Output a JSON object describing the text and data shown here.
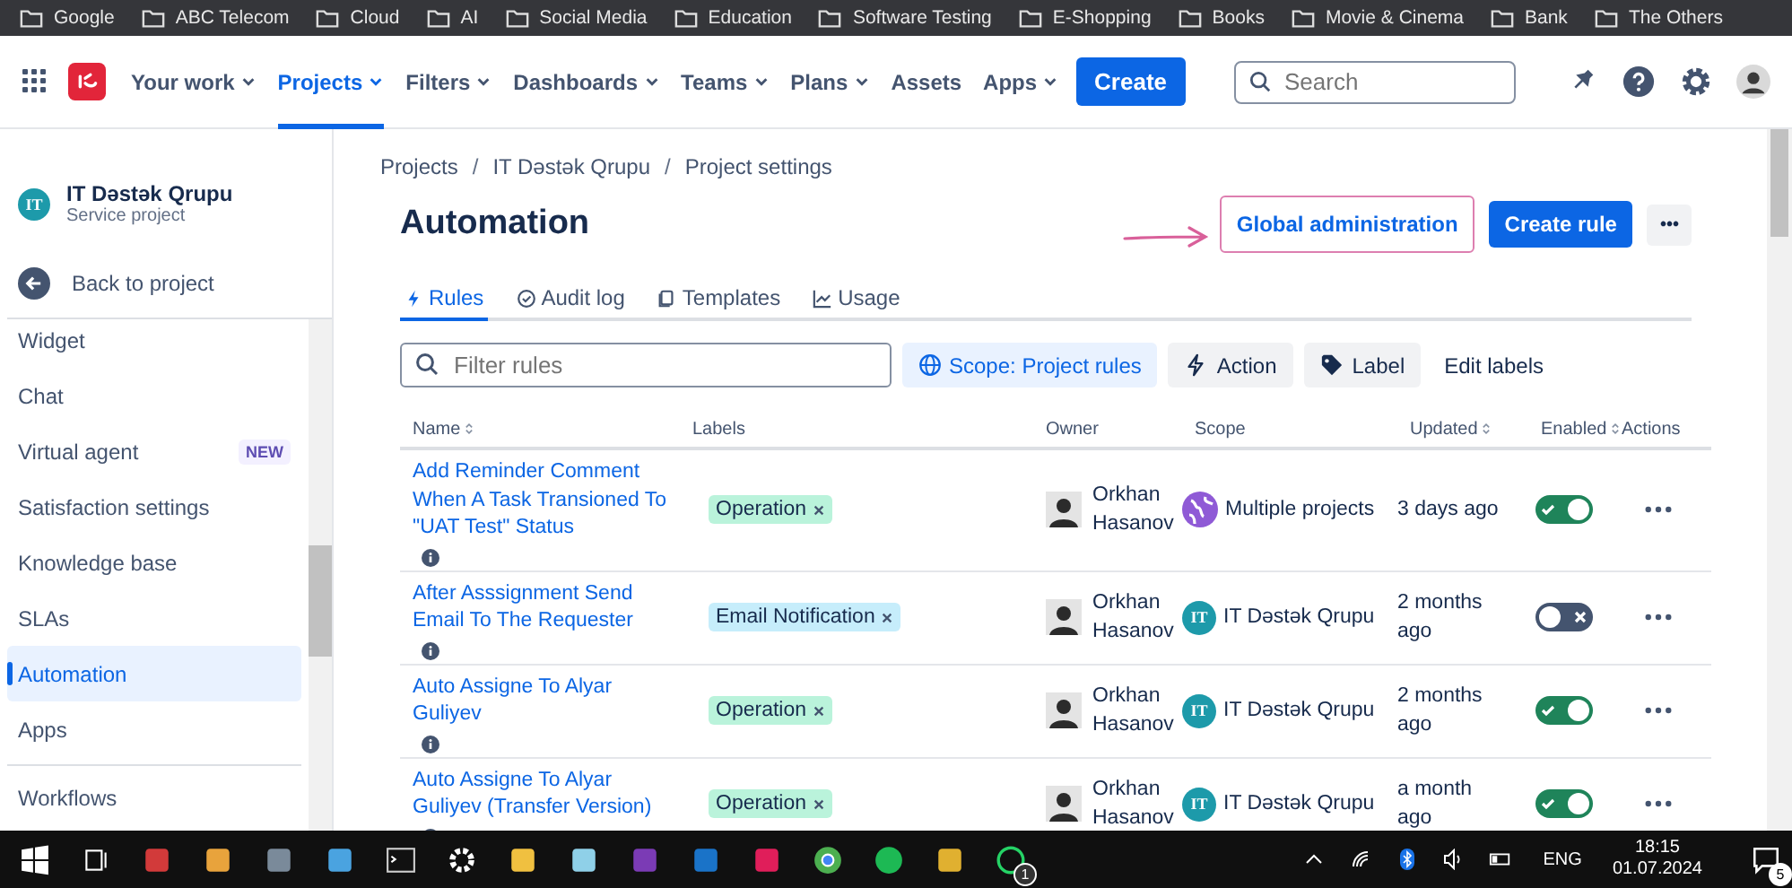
{
  "bookmarks": [
    "Google",
    "ABC Telecom",
    "Cloud",
    "AI",
    "Social Media",
    "Education",
    "Software Testing",
    "E-Shopping",
    "Books",
    "Movie & Cinema",
    "Bank",
    "The Others"
  ],
  "nav": {
    "items": [
      {
        "label": "Your work",
        "dropdown": true,
        "selected": false
      },
      {
        "label": "Projects",
        "dropdown": true,
        "selected": true
      },
      {
        "label": "Filters",
        "dropdown": true,
        "selected": false
      },
      {
        "label": "Dashboards",
        "dropdown": true,
        "selected": false
      },
      {
        "label": "Teams",
        "dropdown": true,
        "selected": false
      },
      {
        "label": "Plans",
        "dropdown": true,
        "selected": false
      },
      {
        "label": "Assets",
        "dropdown": false,
        "selected": false
      },
      {
        "label": "Apps",
        "dropdown": true,
        "selected": false
      }
    ],
    "create": "Create",
    "search_placeholder": "Search"
  },
  "sidebar": {
    "project": {
      "badge": "IT",
      "name": "IT Dəstək Qrupu",
      "type": "Service project"
    },
    "back": "Back to project",
    "items": [
      {
        "label": "Widget",
        "selected": false
      },
      {
        "label": "Chat",
        "selected": false
      },
      {
        "label": "Virtual agent",
        "badge": "NEW",
        "selected": false
      },
      {
        "label": "Satisfaction settings",
        "selected": false
      },
      {
        "label": "Knowledge base",
        "selected": false
      },
      {
        "label": "SLAs",
        "selected": false
      },
      {
        "label": "Automation",
        "selected": true
      },
      {
        "label": "Apps",
        "selected": false
      }
    ],
    "section_items": [
      {
        "label": "Workflows",
        "selected": false
      }
    ]
  },
  "breadcrumbs": [
    "Projects",
    "IT Dəstək Qrupu",
    "Project settings"
  ],
  "breadcrumb_separator": "/",
  "title": "Automation",
  "header_buttons": {
    "global": "Global administration",
    "create": "Create rule",
    "more": "•••"
  },
  "tabs": [
    {
      "label": "Rules",
      "selected": true
    },
    {
      "label": "Audit log",
      "selected": false
    },
    {
      "label": "Templates",
      "selected": false
    },
    {
      "label": "Usage",
      "selected": false
    }
  ],
  "filter": {
    "placeholder": "Filter rules"
  },
  "filter_buttons": [
    {
      "label": "Scope: Project rules",
      "kind": "scope",
      "selected": true
    },
    {
      "label": "Action",
      "kind": "action",
      "selected": false
    },
    {
      "label": "Label",
      "kind": "label",
      "selected": false
    },
    {
      "label": "Edit labels",
      "kind": "link",
      "selected": false
    }
  ],
  "table": {
    "columns": [
      {
        "label": "Name",
        "sortable": true
      },
      {
        "label": "Labels",
        "sortable": false
      },
      {
        "label": "Owner",
        "sortable": false
      },
      {
        "label": "Scope",
        "sortable": false
      },
      {
        "label": "Updated",
        "sortable": true
      },
      {
        "label": "Enabled",
        "sortable": true
      },
      {
        "label": "Actions",
        "sortable": false
      }
    ],
    "rows": [
      {
        "name": "Add Reminder Comment When A Task Transioned To \"UAT Test\" Status",
        "label": "Operation",
        "color": "#baf3db",
        "owner": "Orkhan Hasanov",
        "scope": {
          "kind": "multiple",
          "text": "Multiple projects"
        },
        "updated": "3 days ago",
        "enabled": true
      },
      {
        "name": "After Asssignment Send Email To The Requester",
        "label": "Email Notification",
        "color": "#c6edfb",
        "owner": "Orkhan Hasanov",
        "scope": {
          "kind": "project",
          "badge": "IT",
          "text": "IT Dəstək Qrupu"
        },
        "updated": "2 months ago",
        "enabled": false
      },
      {
        "name": "Auto Assigne To Alyar Guliyev",
        "label": "Operation",
        "color": "#baf3db",
        "owner": "Orkhan Hasanov",
        "scope": {
          "kind": "project",
          "badge": "IT",
          "text": "IT Dəstək Qrupu"
        },
        "updated": "2 months ago",
        "enabled": true
      },
      {
        "name": "Auto Assigne To Alyar Guliyev (Transfer Version)",
        "label": "Operation",
        "color": "#baf3db",
        "owner": "Orkhan Hasanov",
        "scope": {
          "kind": "project",
          "badge": "IT",
          "text": "IT Dəstək Qrupu"
        },
        "updated": "a month ago",
        "enabled": true
      }
    ]
  },
  "taskbar": {
    "app_badge": "1",
    "language": "ENG",
    "time": "18:15",
    "date": "01.07.2024",
    "notification_count": "5"
  }
}
